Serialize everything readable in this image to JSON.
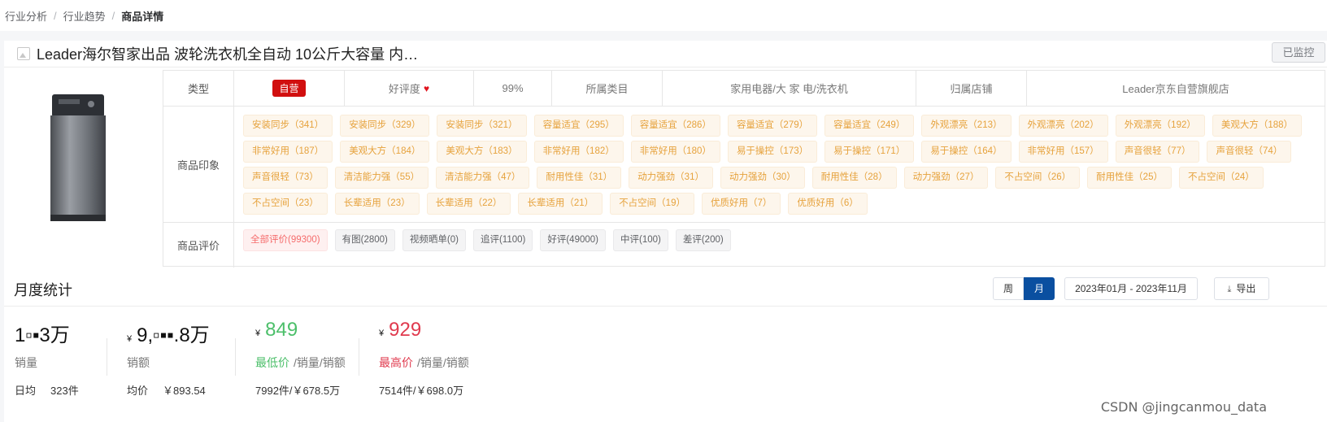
{
  "breadcrumb": [
    "行业分析",
    "行业趋势",
    "商品详情"
  ],
  "product": {
    "title": "Leader海尔智家出品 波轮洗衣机全自动 10公斤大容量 内…",
    "monitor_label": "已监控"
  },
  "attributes": {
    "type_label": "类型",
    "type_value": "自营",
    "rating_label": "好评度",
    "rating_value": "99%",
    "category_label": "所属类目",
    "category_value": "家用电器/大 家 电/洗衣机",
    "shop_label": "归属店铺",
    "shop_value": "Leader京东自营旗舰店"
  },
  "impressions": {
    "label": "商品印象",
    "tags": [
      "安装同步（341）",
      "安装同步（329）",
      "安装同步（321）",
      "容量适宜（295）",
      "容量适宜（286）",
      "容量适宜（279）",
      "容量适宜（249）",
      "外观漂亮（213）",
      "外观漂亮（202）",
      "外观漂亮（192）",
      "美观大方（188）",
      "非常好用（187）",
      "美观大方（184）",
      "美观大方（183）",
      "非常好用（182）",
      "非常好用（180）",
      "易于操控（173）",
      "易于操控（171）",
      "易于操控（164）",
      "非常好用（157）",
      "声音很轻（77）",
      "声音很轻（74）",
      "声音很轻（73）",
      "清洁能力强（55）",
      "清洁能力强（47）",
      "耐用性佳（31）",
      "动力强劲（31）",
      "动力强劲（30）",
      "耐用性佳（28）",
      "动力强劲（27）",
      "不占空间（26）",
      "耐用性佳（25）",
      "不占空间（24）",
      "不占空间（23）",
      "长辈适用（23）",
      "长辈适用（22）",
      "长辈适用（21）",
      "不占空间（19）",
      "优质好用（7）",
      "优质好用（6）"
    ]
  },
  "reviews": {
    "label": "商品评价",
    "buttons": [
      "全部评价(99300)",
      "有图(2800)",
      "视频晒单(0)",
      "追评(1100)",
      "好评(49000)",
      "中评(100)",
      "差评(200)"
    ]
  },
  "monthly": {
    "title": "月度统计",
    "toggle": [
      "周",
      "月"
    ],
    "date_range": "2023年01月 - 2023年11月",
    "export_label": "导出",
    "sales_qty": {
      "value": "1▫▪3万",
      "label": "销量",
      "foot_label": "日均",
      "foot_value": "323件"
    },
    "sales_amt": {
      "currency": "¥",
      "value": "9,▫▪▪.8万",
      "label": "销额",
      "foot_label": "均价",
      "foot_value": "￥893.54"
    },
    "min_price": {
      "currency": "¥",
      "value": "849",
      "label": "最低价",
      "label_suffix": "/销量/销额",
      "foot": "7992件/￥678.5万"
    },
    "max_price": {
      "currency": "¥",
      "value": "929",
      "label": "最高价",
      "label_suffix": "/销量/销额",
      "foot": "7514件/￥698.0万"
    }
  },
  "watermark": "CSDN @jingcanmou_data",
  "colors": {
    "accent": "#0a4fa0",
    "tag_text": "#e6a23c",
    "self_badge": "#d10f0f",
    "min_green": "#4cbf6a",
    "max_red": "#e03a4e"
  }
}
